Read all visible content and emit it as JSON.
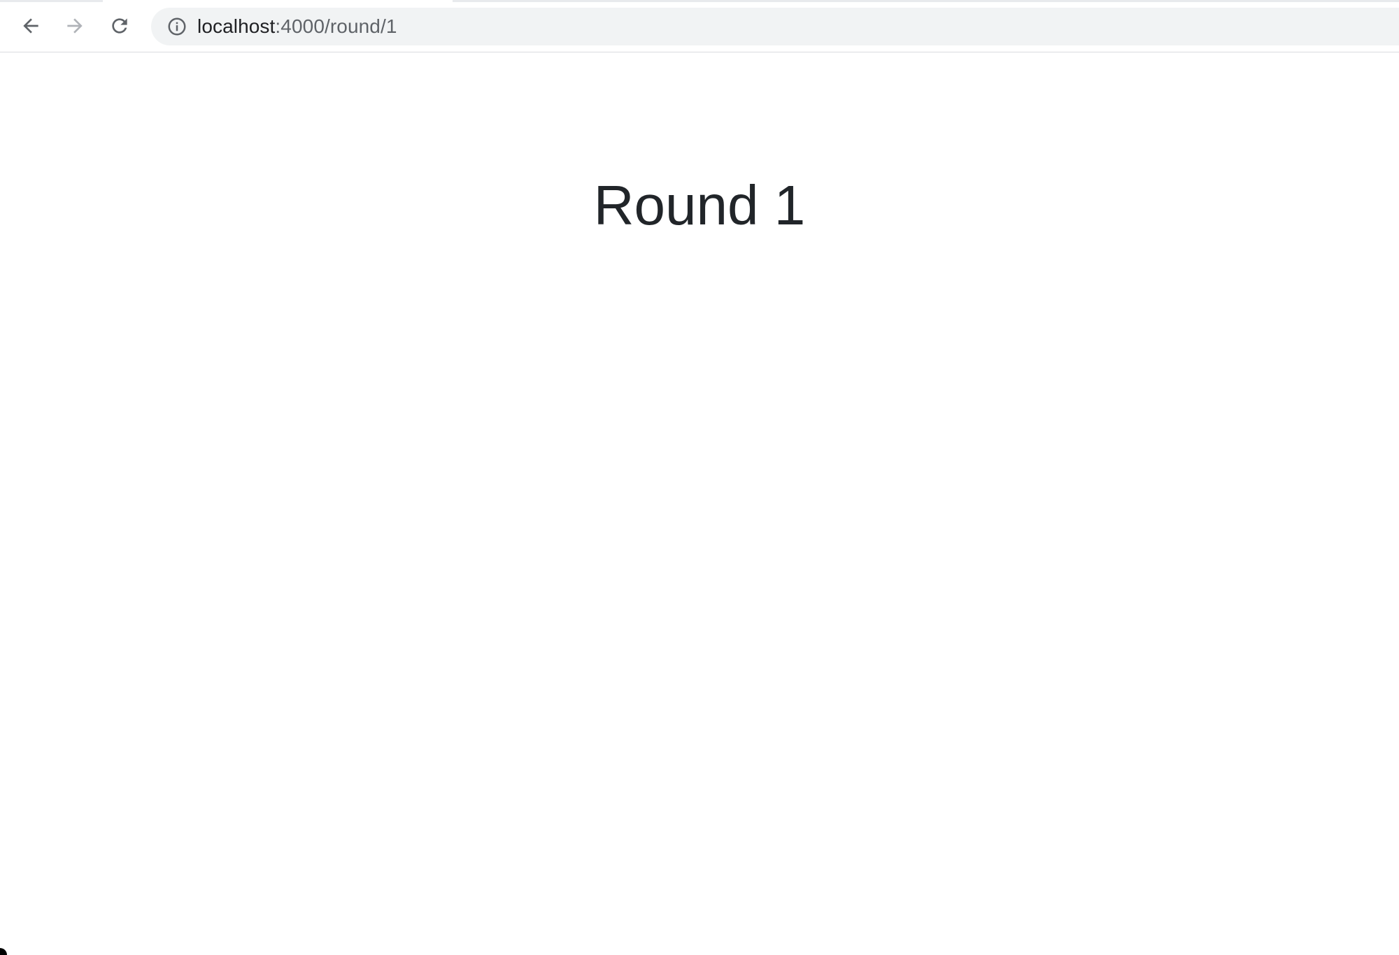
{
  "browser": {
    "url_host": "localhost",
    "url_path": ":4000/round/1",
    "icons": {
      "back": "arrow-left-icon",
      "forward": "arrow-right-icon",
      "reload": "reload-icon",
      "site_info": "info-icon"
    }
  },
  "page": {
    "title": "Round 1"
  },
  "colors": {
    "title_text": "#212529",
    "omnibox_bg": "#f1f3f4"
  }
}
